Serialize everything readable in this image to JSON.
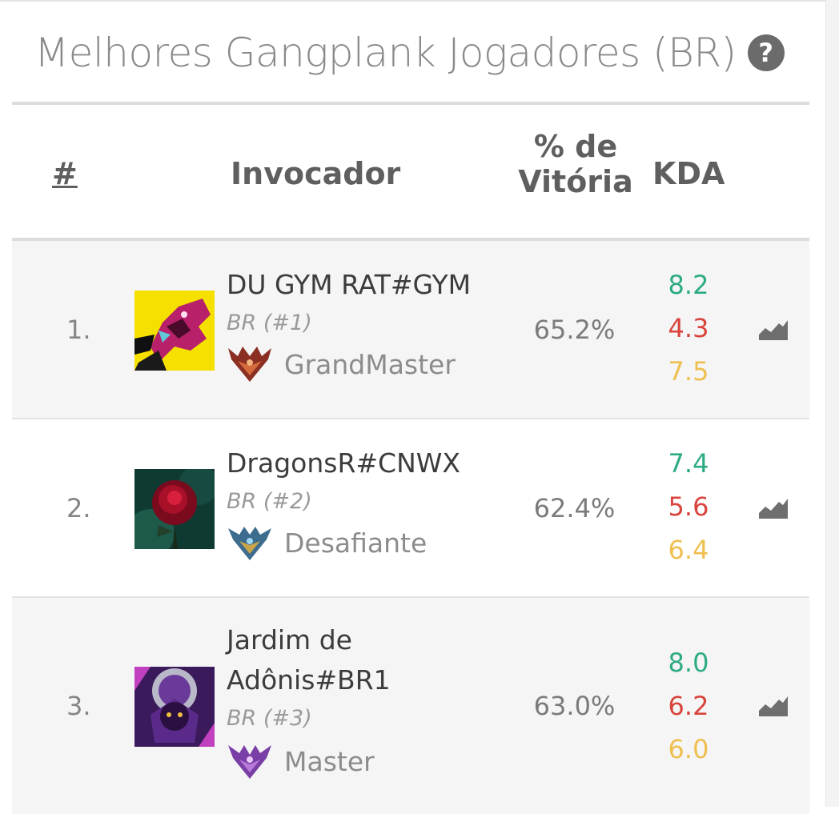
{
  "page": {
    "title": "Melhores Gangplank Jogadores (BR)",
    "help_icon": "question-circle-icon"
  },
  "table": {
    "headers": {
      "rank": "#",
      "name": "Invocador",
      "win_line1": "% de",
      "win_line2": "Vitória",
      "kda": "KDA"
    },
    "rows": [
      {
        "rank": "1.",
        "name": "DU GYM RAT#GYM",
        "region": "BR (#1)",
        "tier": "GrandMaster",
        "tier_color": "#9a3a2a",
        "win": "65.2%",
        "kills": "8.2",
        "deaths": "4.3",
        "assists": "7.5",
        "avatar_bg": "#f5e000",
        "avatar_fg": "#b8206a"
      },
      {
        "rank": "2.",
        "name": "DragonsR#CNWX",
        "region": "BR (#2)",
        "tier": "Desafiante",
        "tier_color": "#4c7ea6",
        "win": "62.4%",
        "kills": "7.4",
        "deaths": "5.6",
        "assists": "6.4",
        "avatar_bg": "#0f3a32",
        "avatar_fg": "#a8102a"
      },
      {
        "rank": "3.",
        "name": "Jardim de Adônis#BR1",
        "region": "BR (#3)",
        "tier": "Master",
        "tier_color": "#8b54b5",
        "win": "63.0%",
        "kills": "8.0",
        "deaths": "6.2",
        "assists": "6.0",
        "avatar_bg": "#3a1a5a",
        "avatar_fg": "#8a4bd0"
      }
    ]
  },
  "colors": {
    "kills": "#2eab85",
    "deaths": "#d9443c",
    "assists": "#efbf4f"
  }
}
